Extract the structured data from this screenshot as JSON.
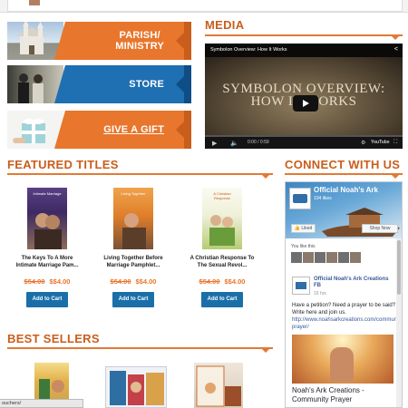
{
  "banners": [
    {
      "label_line1": "PARISH/",
      "label_line2": "MINISTRY"
    },
    {
      "label_line1": "STORE",
      "label_line2": ""
    },
    {
      "label_line1": "GIVE A GIFT",
      "label_line2": ""
    }
  ],
  "media": {
    "title": "MEDIA",
    "video": {
      "title_bar": "Symbolon Overview: How It Works",
      "frame_line1": "SYMBOLON OVERVIEW:",
      "frame_line2": "HOW IT WORKS",
      "time": "0:00 / 0:59",
      "brand": "YouTube"
    }
  },
  "featured": {
    "title": "FEATURED TITLES",
    "products": [
      {
        "name": "The Keys To A More Intimate Marriage Pam...",
        "old_price": "$54.00",
        "new_price": "$$4.00",
        "cart_label": "Add to Cart",
        "cover_text": "Intimate Marriage"
      },
      {
        "name": "Living Together Before Marriage Pamphlet...",
        "old_price": "$54.00",
        "new_price": "$$4.00",
        "cart_label": "Add to Cart",
        "cover_text": "Living Together"
      },
      {
        "name": "A Christian Response To The Sexual Revol...",
        "old_price": "$54.00",
        "new_price": "$$4.00",
        "cart_label": "Add to Cart",
        "cover_text": "A Christian Response"
      }
    ]
  },
  "best_sellers": {
    "title": "BEST SELLERS"
  },
  "connect": {
    "title": "CONNECT WITH US",
    "page_name": "Official Noah's Ark",
    "likes": "104 likes",
    "liked_label": "Liked",
    "shop_label": "Shop Now",
    "you_like": "You like this",
    "post_author": "Official Noah's Ark Creations FB",
    "post_time": "16 hrs",
    "post_text": "Have a petition? Need a prayer to be said? Write here and join us.",
    "post_link": "http://www.noahsarkcreations.com/community-prayer/",
    "post_caption": "Noah's Ark Creations - Community Prayer"
  },
  "status_bar": "ouchers/"
}
